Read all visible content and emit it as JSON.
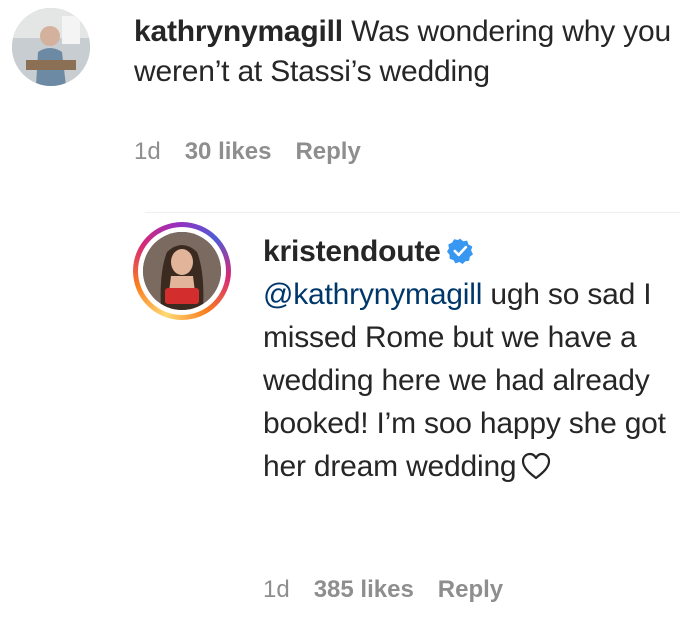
{
  "comments": [
    {
      "username": "kathrynymagill",
      "text": "Was wondering why you weren’t at Stassi’s wedding",
      "time": "1d",
      "likes": "30 likes",
      "reply": "Reply"
    },
    {
      "username": "kristendoute",
      "mention": "@kathrynymagill",
      "text": " ugh so sad I missed Rome but we have a wedding here we had already booked! I’m soo happy she got her dream wedding",
      "time": "1d",
      "likes": "385 likes",
      "reply": "Reply"
    }
  ],
  "colors": {
    "verified": "#3897f0",
    "mention": "#00376b",
    "meta": "#8e8e8e"
  },
  "icons": [
    "verified-badge-icon",
    "white-heart-icon"
  ]
}
